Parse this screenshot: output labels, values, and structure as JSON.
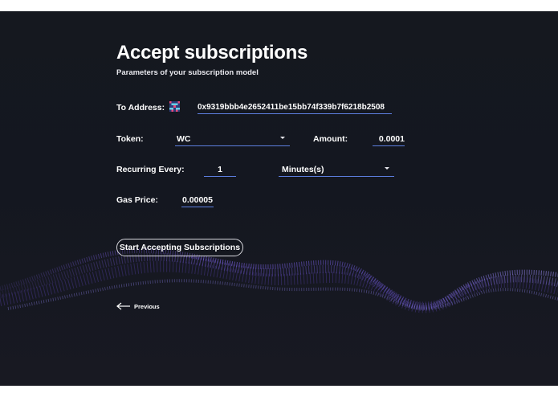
{
  "page": {
    "title": "Accept subscriptions",
    "subtitle": "Parameters of your subscription model"
  },
  "form": {
    "to_address_label": "To Address:",
    "to_address_value": "0x9319bbb4e2652411be15bb74f339b7f6218b2508",
    "token_label": "Token:",
    "token_value": "WC",
    "amount_label": "Amount:",
    "amount_value": "0.0001",
    "recurring_label": "Recurring Every:",
    "recurring_value": "1",
    "period_value": "Minutes(s)",
    "gas_price_label": "Gas Price:",
    "gas_price_value": "0.00005"
  },
  "actions": {
    "start_label": "Start Accepting Subscriptions",
    "previous_label": "Previous"
  },
  "colors": {
    "background": "#15181f",
    "accent_underline": "#5d7fe0",
    "wave": "#6a4fc4"
  },
  "icons": {
    "avatar": "identicon",
    "dropdown": "caret-down-icon",
    "back": "arrow-left-icon"
  }
}
